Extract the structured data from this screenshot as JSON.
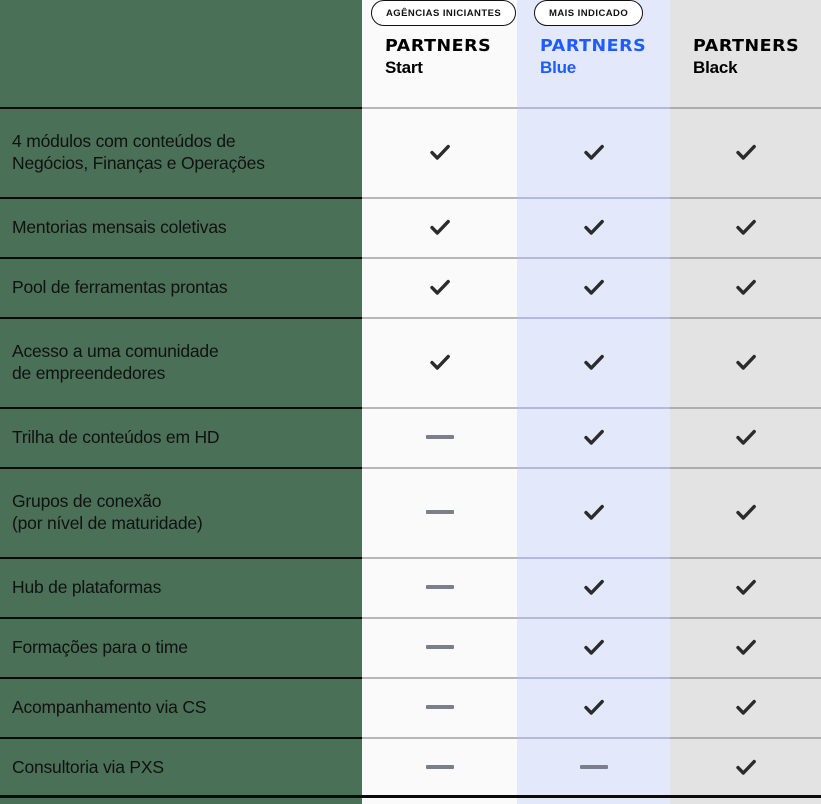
{
  "theme": {
    "page_background": "#4a7057",
    "column_start_bg": "#fafafa",
    "column_blue_bg": "#e4e8fb",
    "column_black_bg": "#e3e3e3",
    "brand_blue": "#1f5cff",
    "text_dark": "#111111",
    "check_color": "#2b2b2b",
    "dash_color": "#7b7f8c"
  },
  "badges": [
    {
      "id": "agencias-iniciantes",
      "label": "AGÊNCIAS INICIANTES",
      "column": "start"
    },
    {
      "id": "mais-indicado",
      "label": "MAIS INDICADO",
      "column": "blue"
    }
  ],
  "columns": [
    {
      "id": "features",
      "wordmark": "",
      "tier": ""
    },
    {
      "id": "start",
      "wordmark": "PARTNERS",
      "tier": "Start"
    },
    {
      "id": "blue",
      "wordmark": "PARTNERS",
      "tier": "Blue"
    },
    {
      "id": "black",
      "wordmark": "PARTNERS",
      "tier": "Black"
    }
  ],
  "marks": {
    "check": "check-icon",
    "dash": "dash-icon"
  },
  "rows": [
    {
      "feature": "4 módulos com conteúdos de\nNegócios, Finanças e Operações",
      "start": "check",
      "blue": "check",
      "black": "check"
    },
    {
      "feature": "Mentorias mensais coletivas",
      "start": "check",
      "blue": "check",
      "black": "check"
    },
    {
      "feature": "Pool de ferramentas prontas",
      "start": "check",
      "blue": "check",
      "black": "check"
    },
    {
      "feature": "Acesso a uma comunidade\nde empreendedores",
      "start": "check",
      "blue": "check",
      "black": "check"
    },
    {
      "feature": "Trilha de conteúdos em HD",
      "start": "dash",
      "blue": "check",
      "black": "check"
    },
    {
      "feature": "Grupos de conexão\n(por nível de maturidade)",
      "start": "dash",
      "blue": "check",
      "black": "check"
    },
    {
      "feature": "Hub de plataformas",
      "start": "dash",
      "blue": "check",
      "black": "check"
    },
    {
      "feature": "Formações para o time",
      "start": "dash",
      "blue": "check",
      "black": "check"
    },
    {
      "feature": "Acompanhamento via CS",
      "start": "dash",
      "blue": "check",
      "black": "check"
    },
    {
      "feature": "Consultoria via PXS",
      "start": "dash",
      "blue": "dash",
      "black": "check"
    }
  ]
}
